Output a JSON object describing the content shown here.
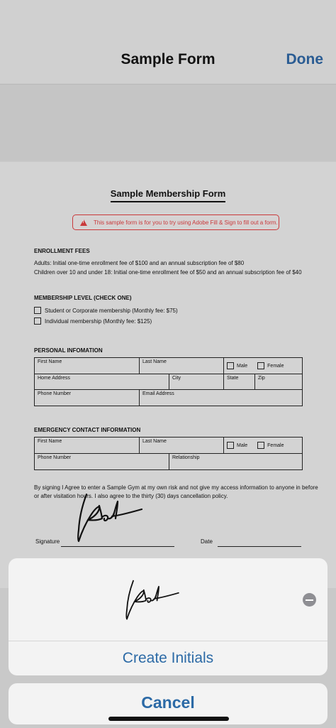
{
  "nav": {
    "title": "Sample Form",
    "done_label": "Done"
  },
  "doc": {
    "title": "Sample Membership Form",
    "notice": "This sample form is for you to try using Adobe Fill & Sign to fill out a form.",
    "enrollment": {
      "heading": "ENROLLMENT FEES",
      "line1": "Adults: Initial one-time enrollment fee of $100 and an annual subscription fee of $80",
      "line2": "Children over 10 and under 18: Initial one-time enrollment fee of $50 and an annual subscription fee of $40"
    },
    "membership": {
      "heading": "MEMBERSHIP LEVEL (CHECK ONE)",
      "options": [
        "Student or Corporate membership (Monthly fee: $75)",
        "Individual membership (Monthly fee: $125)"
      ]
    },
    "personal": {
      "heading": "PERSONAL INFOMATION",
      "first_name": "First Name",
      "last_name": "Last Name",
      "male": "Male",
      "female": "Female",
      "home_address": "Home Address",
      "city": "City",
      "state": "State",
      "zip": "Zip",
      "phone": "Phone Number",
      "email": "Email Address"
    },
    "emergency": {
      "heading": "EMERGENCY CONTACT INFORMATION",
      "first_name": "First Name",
      "last_name": "Last Name",
      "male": "Male",
      "female": "Female",
      "phone": "Phone Number",
      "relationship": "Relationship"
    },
    "agreement": {
      "line1": "By signing I Agree to enter a Sample Gym at my own risk and not give my access information to anyone in before",
      "line2": "or after visitation hours. I also agree to the thirty (30) days cancellation policy."
    },
    "signature_label": "Signature",
    "date_label": "Date"
  },
  "sheet": {
    "create_initials_label": "Create Initials"
  },
  "cancel_label": "Cancel",
  "colors": {
    "accent": "#2c6aa6",
    "done": "#2a5c93",
    "warning": "#c9393b"
  }
}
